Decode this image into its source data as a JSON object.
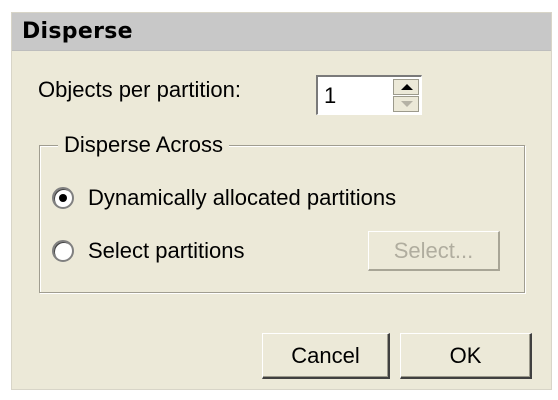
{
  "dialog": {
    "title": "Disperse",
    "objects_per_partition": {
      "label": "Objects per partition:",
      "value": "1"
    },
    "disperse_across": {
      "legend": "Disperse Across",
      "options": [
        {
          "label": "Dynamically allocated partitions",
          "selected": true
        },
        {
          "label": "Select partitions",
          "selected": false
        }
      ],
      "select_button": {
        "label": "Select...",
        "enabled": false
      }
    },
    "buttons": {
      "cancel": "Cancel",
      "ok": "OK"
    }
  },
  "colors": {
    "dialog_background": "#ece9d8",
    "titlebar_background": "#c8c8c8",
    "disabled_text": "#b0ad9f"
  },
  "icons": {
    "spin_up": "spin-up-arrow-icon",
    "spin_down": "spin-down-arrow-icon"
  }
}
